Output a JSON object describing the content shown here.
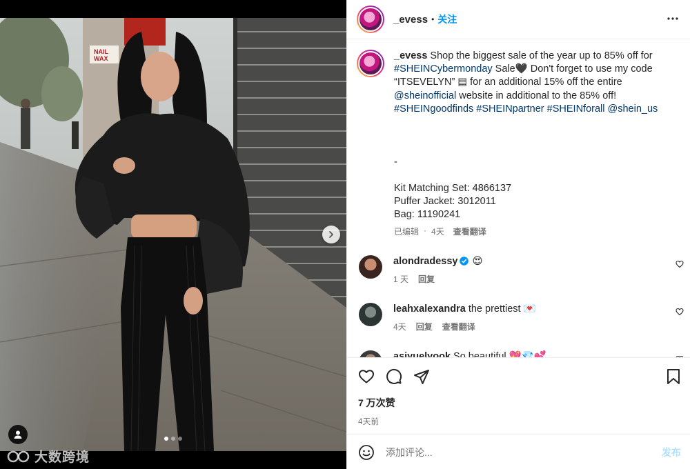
{
  "header": {
    "username": "_evess",
    "separator": "•",
    "follow_label": "关注"
  },
  "caption": {
    "username": "_evess",
    "text_1": " Shop the biggest sale of the year up to 85% off for ",
    "hashtag_cybermonday": "#SHEINCybermonday",
    "text_2": " Sale🖤 Don't forget to use my code “ITSEVELYN” ▤ for an additional 15% off the entire ",
    "mention_sheinofficial": "@sheinofficial",
    "text_3": " website in additional to the 85% off! ",
    "hashtag_goodfinds": "#SHEINgoodfinds",
    "hashtag_partner": "#SHEINpartner",
    "hashtag_forall": "#SHEINforall",
    "mention_shein_us": "@shein_us",
    "items_block": "\n\n\n\n-\n\nKit Matching Set: 4866137\nPuffer Jacket: 3012011\nBag: 11190241",
    "edited": "已编辑",
    "dot": "·",
    "time": "4天",
    "translate": "查看翻译"
  },
  "comments": [
    {
      "username": "alondradessy",
      "verified": true,
      "text": " 😍",
      "time": "1 天",
      "reply": "回复",
      "translate": ""
    },
    {
      "username": "leahxalexandra",
      "verified": false,
      "text": " the prettiest 💌",
      "time": "4天",
      "reply": "回复",
      "translate": "查看翻译"
    },
    {
      "username": "asiyuelyook",
      "verified": false,
      "text": " So beautiful 💖💎💕",
      "time": "",
      "reply": "",
      "translate": ""
    }
  ],
  "actions": {
    "likes": "7 万次赞",
    "posted": "4天前"
  },
  "composer": {
    "placeholder": "添加评论...",
    "post_label": "发布"
  },
  "media": {
    "watermark": "大数跨境",
    "carousel_dots": 3,
    "active_dot": 0
  },
  "colors": {
    "link_blue": "#0095f6",
    "hashtag_blue": "#00376b",
    "muted_gray": "#737373",
    "post_button_disabled": "#b2dffc"
  }
}
